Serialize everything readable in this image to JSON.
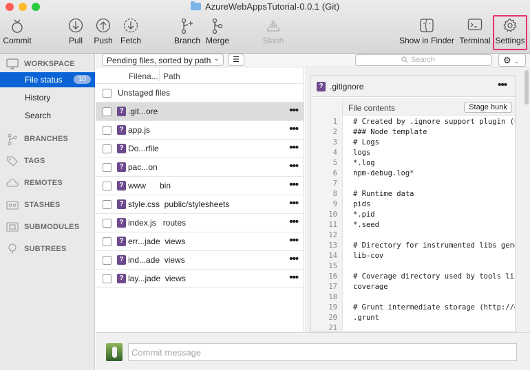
{
  "window": {
    "title": "AzureWebAppsTutorial-0.0.1 (Git)"
  },
  "colors": {
    "close": "#fd5f57",
    "minimize": "#febb2e",
    "zoom": "#29c940",
    "accent": "#0a64d6",
    "highlight": "#e8306a",
    "untracked_badge": "#6d4a8d"
  },
  "toolbar": {
    "commit": "Commit",
    "pull": "Pull",
    "push": "Push",
    "fetch": "Fetch",
    "branch": "Branch",
    "merge": "Merge",
    "stash": "Stash",
    "show_in_finder": "Show in Finder",
    "terminal": "Terminal",
    "settings": "Settings"
  },
  "sidebar": {
    "workspace": "WORKSPACE",
    "file_status": "File status",
    "file_status_count": "10",
    "history": "History",
    "search": "Search",
    "branches": "BRANCHES",
    "tags": "TAGS",
    "remotes": "REMOTES",
    "stashes": "STASHES",
    "submodules": "SUBMODULES",
    "subtrees": "SUBTREES"
  },
  "filter": {
    "sort_label": "Pending files, sorted by path",
    "search_placeholder": "Search"
  },
  "filelist": {
    "col_filename": "Filena...",
    "col_path": "Path",
    "group": "Unstaged files",
    "files": [
      {
        "name": ".git...ore"
      },
      {
        "name": "app.js"
      },
      {
        "name": "Do...rfile"
      },
      {
        "name": "pac...on"
      },
      {
        "name": "www      bin"
      },
      {
        "name": "style.css  public/stylesheets"
      },
      {
        "name": "index.js   routes"
      },
      {
        "name": "err...jade  views"
      },
      {
        "name": "ind...ade  views"
      },
      {
        "name": "lay...jade  views"
      }
    ]
  },
  "diff": {
    "filename": ".gitignore",
    "contents_label": "File contents",
    "stage_hunk": "Stage hunk",
    "lines": [
      {
        "n": "1",
        "t": "# Created by .ignore support plugin (hs"
      },
      {
        "n": "2",
        "t": "### Node template"
      },
      {
        "n": "3",
        "t": "# Logs"
      },
      {
        "n": "4",
        "t": "logs"
      },
      {
        "n": "5",
        "t": "*.log"
      },
      {
        "n": "6",
        "t": "npm-debug.log*"
      },
      {
        "n": "7",
        "t": ""
      },
      {
        "n": "8",
        "t": "# Runtime data"
      },
      {
        "n": "9",
        "t": "pids"
      },
      {
        "n": "10",
        "t": "*.pid"
      },
      {
        "n": "11",
        "t": "*.seed"
      },
      {
        "n": "12",
        "t": ""
      },
      {
        "n": "13",
        "t": "# Directory for instrumented libs gener"
      },
      {
        "n": "14",
        "t": "lib-cov"
      },
      {
        "n": "15",
        "t": ""
      },
      {
        "n": "16",
        "t": "# Coverage directory used by tools like"
      },
      {
        "n": "17",
        "t": "coverage"
      },
      {
        "n": "18",
        "t": ""
      },
      {
        "n": "19",
        "t": "# Grunt intermediate storage (http://gr"
      },
      {
        "n": "20",
        "t": ".grunt"
      },
      {
        "n": "21",
        "t": ""
      }
    ]
  },
  "commit": {
    "placeholder": "Commit message"
  }
}
